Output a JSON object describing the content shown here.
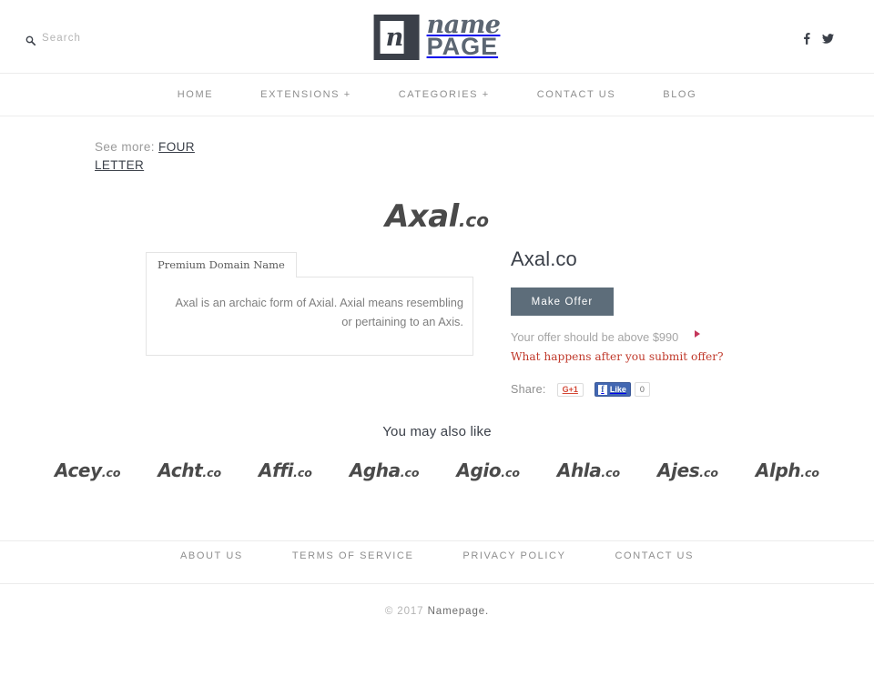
{
  "header": {
    "search": {
      "icon": "search-icon",
      "label": "Search"
    },
    "logo": {
      "mark_letter": "n",
      "name": "name",
      "page": "PAGE"
    },
    "social": [
      {
        "icon": "facebook-icon",
        "label": "f"
      },
      {
        "icon": "twitter-icon",
        "label": "twitter"
      }
    ]
  },
  "nav": {
    "items": [
      {
        "label": "HOME"
      },
      {
        "label": "EXTENSIONS +"
      },
      {
        "label": "CATEGORIES +"
      },
      {
        "label": "CONTACT US"
      },
      {
        "label": "BLOG"
      }
    ]
  },
  "see_more": {
    "label": "See more:",
    "value": "FOUR LETTER"
  },
  "wordmark": {
    "name": "Axal",
    "tld": ".co"
  },
  "tab_panel": {
    "tab_label": "Premium Domain Name",
    "description": "Axal is an archaic form of Axial. Axial means resembling or pertaining to an Axis."
  },
  "offer": {
    "title": "Axal.co",
    "button_label": "Make Offer",
    "note": "Your offer should be above $990",
    "minimum": "$990",
    "after_link": "What happens after you submit offer?",
    "share_label": "Share:",
    "gplus_label": "G+1",
    "fb_f": "f",
    "fb_like_label": "Like",
    "fb_count": "0"
  },
  "also_like": {
    "title": "You may also like",
    "items": [
      {
        "name": "Acey",
        "tld": ".co"
      },
      {
        "name": "Acht",
        "tld": ".co"
      },
      {
        "name": "Affi",
        "tld": ".co"
      },
      {
        "name": "Agha",
        "tld": ".co"
      },
      {
        "name": "Agio",
        "tld": ".co"
      },
      {
        "name": "Ahla",
        "tld": ".co"
      },
      {
        "name": "Ajes",
        "tld": ".co"
      },
      {
        "name": "Alph",
        "tld": ".co"
      }
    ]
  },
  "footer": {
    "links": [
      {
        "label": "ABOUT US"
      },
      {
        "label": "TERMS OF SERVICE"
      },
      {
        "label": "PRIVACY POLICY"
      },
      {
        "label": "CONTACT US"
      }
    ],
    "copyright_year": "© 2017",
    "copyright_name": "Namepage."
  },
  "colors": {
    "accent_button": "#5d6d7a",
    "link_red": "#c0392b",
    "logo": "#3b4049",
    "facebook_blue": "#4267b2",
    "gplus_red": "#d34836"
  }
}
